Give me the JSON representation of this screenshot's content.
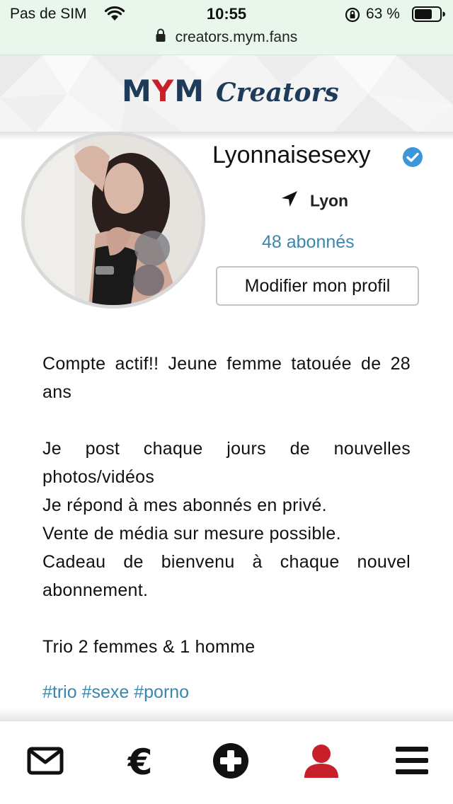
{
  "status_bar": {
    "carrier": "Pas de SIM",
    "time": "10:55",
    "battery": "63 %"
  },
  "url_bar": {
    "url": "creators.mym.fans"
  },
  "header": {
    "logo_m1": "M",
    "logo_y": "Y",
    "logo_m2": "M",
    "logo_creators": "Creators",
    "colors": {
      "navy": "#1f3b5a",
      "red": "#c8202a"
    }
  },
  "profile": {
    "username": "Lyonnaisesexy",
    "verified": true,
    "location": "Lyon",
    "subscribers": "48 abonnés",
    "edit_button": "Modifier mon profil",
    "avatar_icon": "profile-photo"
  },
  "bio": {
    "paragraph1": "Compte actif!! Jeune femme tatouée de 28 ans",
    "paragraph2": "Je post chaque jours de nouvelles photos/vidéos",
    "line3": "Je répond à mes abonnés en privé.",
    "line4": "Vente de média sur mesure possible.",
    "line5": "Cadeau de bienvenu à chaque nouvel abonnement.",
    "line6": "Trio 2 femmes & 1 homme",
    "hashtags": "#trio #sexe #porno"
  },
  "bottom_nav": {
    "items": [
      {
        "icon": "envelope-icon",
        "active": false
      },
      {
        "icon": "euro-icon",
        "label": "€",
        "active": false
      },
      {
        "icon": "plus-circle-icon",
        "active": false
      },
      {
        "icon": "user-icon",
        "active": true
      },
      {
        "icon": "menu-icon",
        "active": false
      }
    ],
    "active_color": "#c8202a",
    "link_color": "#3a87ad"
  }
}
